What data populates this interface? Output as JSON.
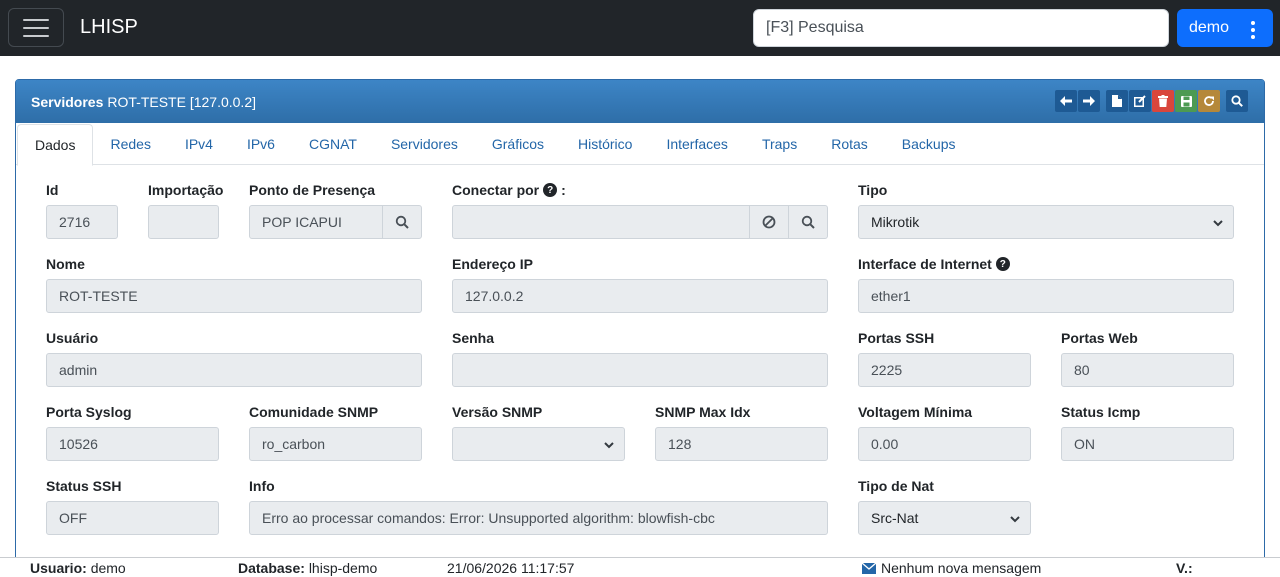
{
  "app": {
    "brand": "LHISP"
  },
  "header": {
    "search_placeholder": "[F3] Pesquisa",
    "user_label": "demo"
  },
  "panel": {
    "title_bold": "Servidores",
    "title_rest": "ROT-TESTE [127.0.0.2]"
  },
  "toolbar": {
    "icons": [
      "arrow-left-icon",
      "arrow-right-icon",
      "new-file-icon",
      "edit-icon",
      "delete-icon",
      "save-icon",
      "refresh-icon",
      "search-icon"
    ]
  },
  "tabs": [
    "Dados",
    "Redes",
    "IPv4",
    "IPv6",
    "CGNAT",
    "Servidores",
    "Gráficos",
    "Histórico",
    "Interfaces",
    "Traps",
    "Rotas",
    "Backups"
  ],
  "form": {
    "id": {
      "label": "Id",
      "value": "2716"
    },
    "importacao": {
      "label": "Importação",
      "value": ""
    },
    "pop": {
      "label": "Ponto de Presença",
      "value": "POP ICAPUI"
    },
    "conectar": {
      "label": "Conectar por",
      "value": ""
    },
    "tipo": {
      "label": "Tipo",
      "value": "Mikrotik"
    },
    "nome": {
      "label": "Nome",
      "value": "ROT-TESTE"
    },
    "endereco_ip": {
      "label": "Endereço IP",
      "value": "127.0.0.2"
    },
    "interface_internet": {
      "label": "Interface de Internet",
      "value": "ether1"
    },
    "usuario": {
      "label": "Usuário",
      "value": "admin"
    },
    "senha": {
      "label": "Senha",
      "value": ""
    },
    "portas_ssh": {
      "label": "Portas SSH",
      "value": "2225"
    },
    "portas_web": {
      "label": "Portas Web",
      "value": "80"
    },
    "porta_syslog": {
      "label": "Porta Syslog",
      "value": "10526"
    },
    "comunidade_snmp": {
      "label": "Comunidade SNMP",
      "value": "ro_carbon"
    },
    "versao_snmp": {
      "label": "Versão SNMP",
      "value": ""
    },
    "snmp_max_idx": {
      "label": "SNMP Max Idx",
      "value": "128"
    },
    "voltagem_minima": {
      "label": "Voltagem Mínima",
      "value": "0.00"
    },
    "status_icmp": {
      "label": "Status Icmp",
      "value": "ON"
    },
    "status_ssh": {
      "label": "Status SSH",
      "value": "OFF"
    },
    "info": {
      "label": "Info",
      "value": "Erro ao processar comandos: Error: Unsupported algorithm: blowfish-cbc"
    },
    "tipo_nat": {
      "label": "Tipo de Nat",
      "value": "Src-Nat"
    }
  },
  "statusbar": {
    "usuario_label": "Usuario:",
    "usuario_value": "demo",
    "database_label": "Database:",
    "database_value": "lhisp-demo",
    "datetime": "21/06/2026 11:17:57",
    "messages": "Nenhum nova mensagem",
    "version_label": "V.:"
  }
}
